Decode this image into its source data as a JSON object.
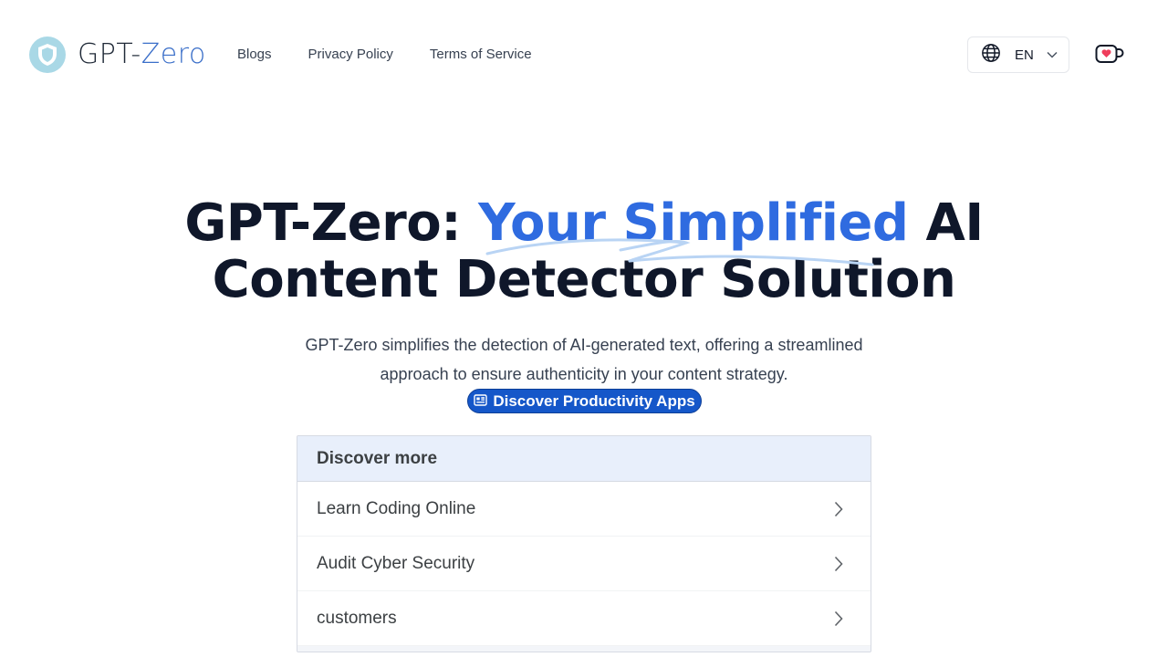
{
  "header": {
    "logo": {
      "part1": "GPT-",
      "part2": "Zero",
      "icon": "shield-icon"
    },
    "nav": [
      {
        "label": "Blogs"
      },
      {
        "label": "Privacy Policy"
      },
      {
        "label": "Terms of Service"
      }
    ],
    "language": {
      "code": "EN",
      "icon": "globe-icon"
    },
    "support_icon": "coffee-cup-heart-icon"
  },
  "hero": {
    "title_start": "GPT-Zero: ",
    "title_highlight": "Your Simplified",
    "title_end_line1": " AI",
    "title_line2": "Content Detector Solution",
    "subtitle": "GPT-Zero simplifies the detection of AI-generated text, offering a streamlined approach to ensure authenticity in your content strategy.",
    "cta": {
      "label": "Discover Productivity Apps",
      "icon": "newspaper-icon"
    }
  },
  "discover": {
    "heading": "Discover more",
    "items": [
      {
        "label": "Learn Coding Online"
      },
      {
        "label": "Audit Cyber Security"
      },
      {
        "label": "customers"
      }
    ]
  },
  "colors": {
    "accent": "#2f6be0",
    "button": "#1557c9",
    "logo_badge": "#a9d8e6",
    "card_header": "#e8effb",
    "title": "#0f172a"
  }
}
